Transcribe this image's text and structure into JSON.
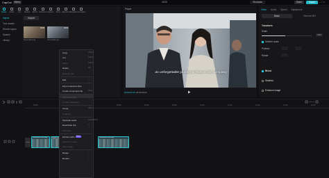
{
  "topbar": {
    "logo": "CapCut",
    "menu": "Menu",
    "project_title": "0828",
    "shortcuts": "Shortcuts",
    "share": "Share",
    "export": "Export"
  },
  "tool_tabs": [
    {
      "label": "Media",
      "active": true
    },
    {
      "label": "Audio"
    },
    {
      "label": "Text"
    },
    {
      "label": "Stickers"
    },
    {
      "label": "Effects"
    },
    {
      "label": "Transitions"
    },
    {
      "label": "Captions"
    },
    {
      "label": "Filters"
    },
    {
      "label": "Adjustment"
    },
    {
      "label": "Templates"
    },
    {
      "label": "AI avatars"
    }
  ],
  "media_side": [
    "Import",
    "Your assets",
    "Shared space",
    "Spaces",
    "Library"
  ],
  "media": {
    "import_label": "Import",
    "thumbs": [
      {
        "name": "Screenshot.png",
        "duration": "00:08"
      },
      {
        "name": "Screenshot.png",
        "duration": "00:05"
      }
    ]
  },
  "player": {
    "label": "Player",
    "subtitle": "an unforgettable journey to Paris in the company",
    "time_current": "00:00:03:15",
    "time_total": "00:00:12:01"
  },
  "inspector": {
    "tabs": [
      {
        "label": "Video",
        "active": true
      },
      {
        "label": "Audio"
      },
      {
        "label": "Speed"
      },
      {
        "label": "Adjustment"
      }
    ],
    "subtabs": [
      "Basic",
      "Remove BG"
    ],
    "transform": "Transform",
    "scale": "Scale",
    "scale_value": "100%",
    "uniform_scale": "Uniform scale",
    "position": "Position",
    "rotate": "Rotate",
    "blend": "Blend",
    "stabilize": "Stabilize",
    "enhance_image": "Enhance image"
  },
  "timeline": {
    "ticks": [
      "00:00",
      "00:10",
      "00:20",
      "00:30",
      "00:40",
      "00:50",
      "01:00",
      "01:10",
      "01:20",
      "01:30",
      "01:40"
    ],
    "cover": "Cover",
    "clips": [
      {
        "name": "Screenshot 2024.mp4"
      },
      {
        "name": "Screenshot 2024.mp4"
      },
      {
        "name": "Screenshot 2024.mp4"
      }
    ]
  },
  "context_menu": [
    {
      "label": "Copy",
      "shortcut": "Ctrl+C"
    },
    {
      "label": "Cut",
      "shortcut": "Ctrl+X"
    },
    {
      "label": "Paste",
      "shortcut": "Ctrl+V",
      "disabled": true
    },
    {
      "label": "Delete",
      "shortcut": "Del"
    },
    {
      "label": "Replace clip",
      "disabled": true
    },
    {
      "label": "Edit",
      "shortcut": ">"
    },
    {
      "label": "Export selected clips"
    },
    {
      "label": "Create compound clip",
      "shortcut": "Alt+G"
    },
    {
      "label": "Compound clip",
      "disabled": true
    },
    {
      "label": "Create subproject",
      "disabled": true
    },
    {
      "label": "Group",
      "shortcut": "Ctrl+G"
    },
    {
      "label": "Ungroup",
      "disabled": true
    },
    {
      "label": "Separate audio",
      "shortcut": "Ctrl+Shift+S"
    },
    {
      "label": "Deactivate clip",
      "shortcut": "V"
    },
    {
      "label": "Link clips",
      "disabled": true
    },
    {
      "label": "Extract audio",
      "badge": "New"
    },
    {
      "label": "Speech to song",
      "disabled": true
    },
    {
      "label": "Video track",
      "disabled": true
    },
    {
      "label": "Range",
      "shortcut": ">"
    },
    {
      "label": "Render",
      "shortcut": ">"
    }
  ],
  "colors": {
    "accent": "#1fc6d4",
    "background": "#101012",
    "panel": "#17171a"
  }
}
